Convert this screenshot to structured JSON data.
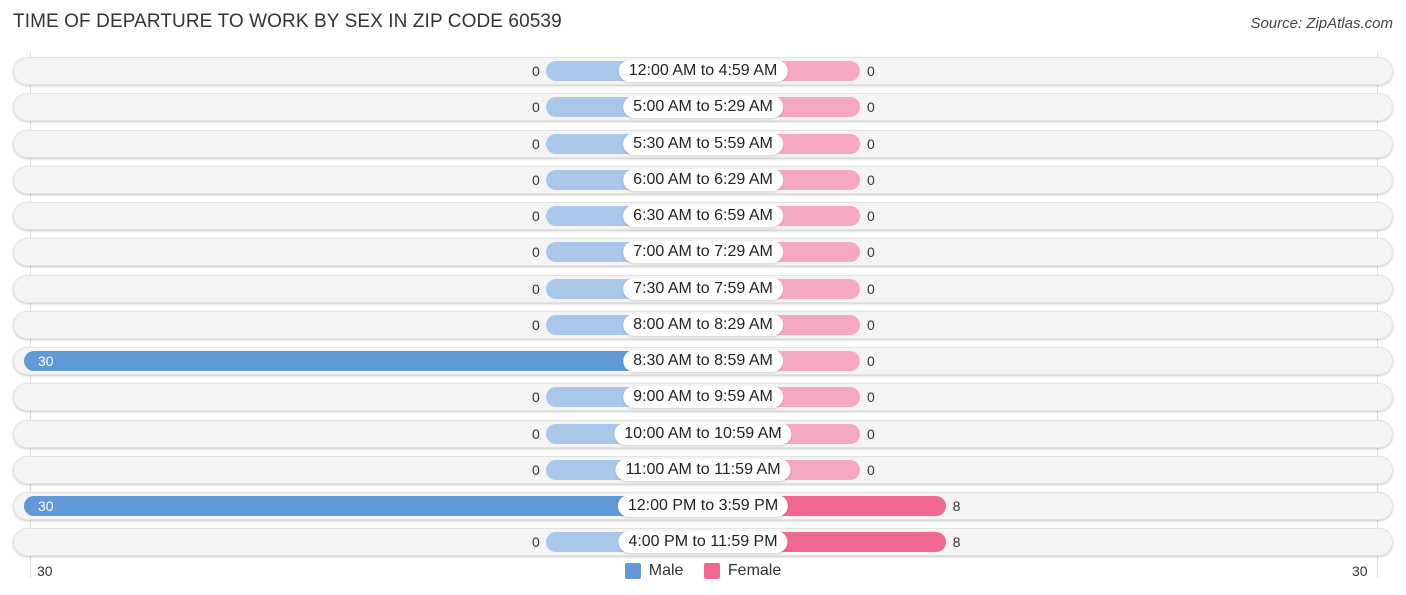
{
  "title": "TIME OF DEPARTURE TO WORK BY SEX IN ZIP CODE 60539",
  "source": "Source: ZipAtlas.com",
  "colors": {
    "male_strong": "#6199d8",
    "male_light": "#a9c7ea",
    "female_strong": "#f06892",
    "female_light": "#f5a8c0"
  },
  "chart_data": {
    "type": "bar",
    "orientation": "horizontal-diverging",
    "title": "TIME OF DEPARTURE TO WORK BY SEX IN ZIP CODE 60539",
    "categories": [
      "12:00 AM to 4:59 AM",
      "5:00 AM to 5:29 AM",
      "5:30 AM to 5:59 AM",
      "6:00 AM to 6:29 AM",
      "6:30 AM to 6:59 AM",
      "7:00 AM to 7:29 AM",
      "7:30 AM to 7:59 AM",
      "8:00 AM to 8:29 AM",
      "8:30 AM to 8:59 AM",
      "9:00 AM to 9:59 AM",
      "10:00 AM to 10:59 AM",
      "11:00 AM to 11:59 AM",
      "12:00 PM to 3:59 PM",
      "4:00 PM to 11:59 PM"
    ],
    "series": [
      {
        "name": "Male",
        "values": [
          0,
          0,
          0,
          0,
          0,
          0,
          0,
          0,
          30,
          0,
          0,
          0,
          30,
          0
        ]
      },
      {
        "name": "Female",
        "values": [
          0,
          0,
          0,
          0,
          0,
          0,
          0,
          0,
          0,
          0,
          0,
          0,
          8,
          8
        ]
      }
    ],
    "axis": {
      "min_label": "30",
      "max_label": "30",
      "range": [
        -30,
        30
      ]
    },
    "legend": {
      "position": "bottom-center",
      "entries": [
        "Male",
        "Female"
      ]
    }
  }
}
